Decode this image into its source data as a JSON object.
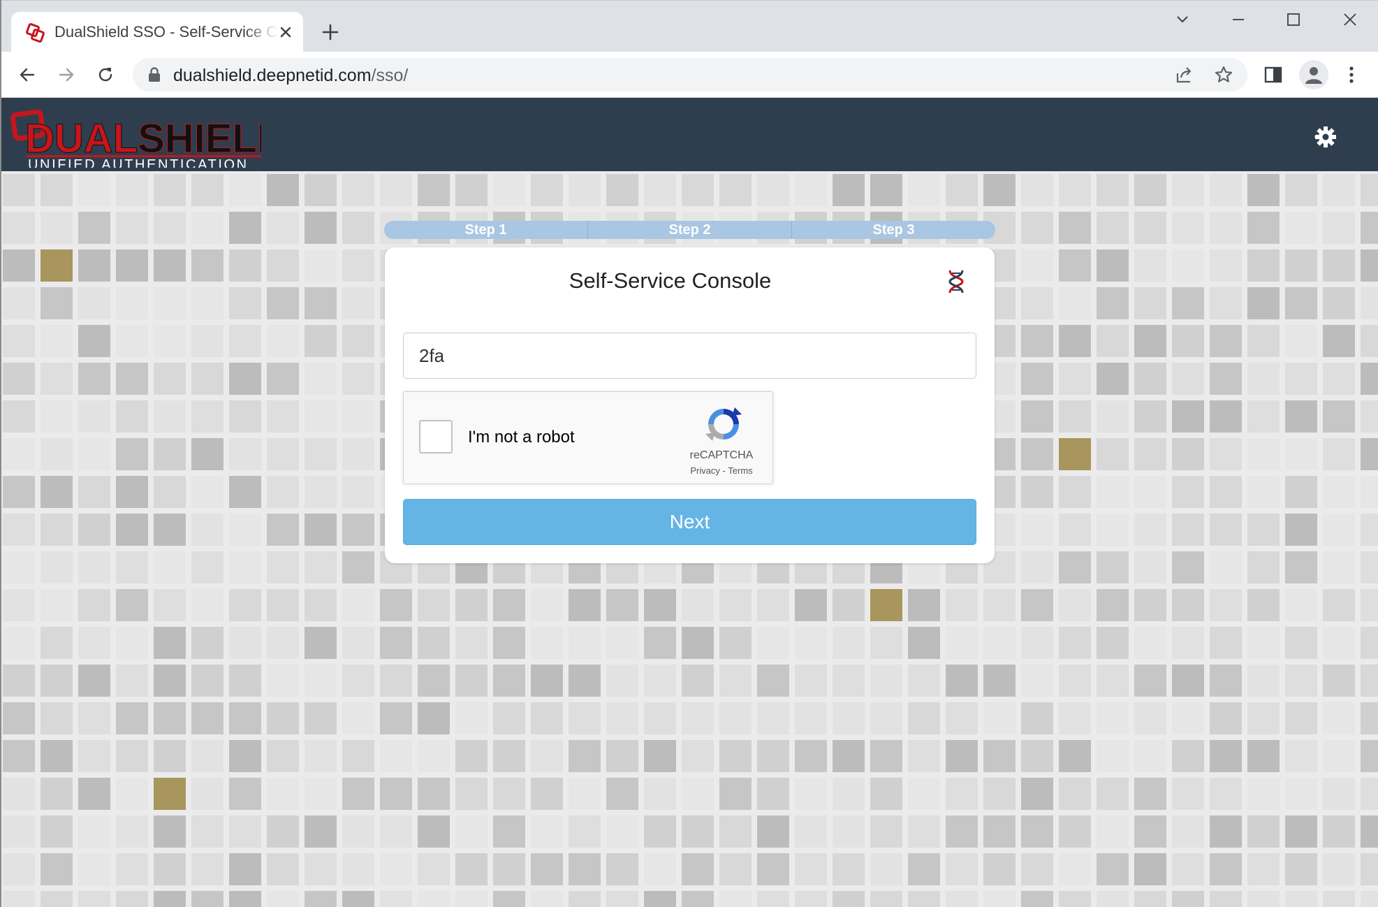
{
  "browser": {
    "tab_title": "DualShield SSO - Self-Service Console",
    "url_host": "dualshield.deepnetid.com",
    "url_path": "/sso/",
    "icons": [
      "dualshield-favicon-icon",
      "close-icon",
      "plus-icon",
      "chevron-down-icon",
      "minimize-icon",
      "maximize-icon",
      "close-icon",
      "back-arrow-icon",
      "forward-arrow-icon",
      "reload-icon",
      "lock-icon",
      "share-icon",
      "star-icon",
      "side-panel-icon",
      "profile-icon",
      "kebab-menu-icon"
    ]
  },
  "header": {
    "logo_name": "DUALSHIELD",
    "logo_name_red": "D",
    "logo_name_rest_red": "UAL",
    "logo_name_black": "SHIELD",
    "logo_tagline": "UNIFIED AUTHENTICATION",
    "settings_icon": "gear-icon"
  },
  "wizard": {
    "steps": [
      "Step 1",
      "Step 2",
      "Step 3"
    ],
    "title": "Self-Service Console",
    "username_value": "2fa",
    "recaptcha": {
      "label": "I'm not a robot",
      "brand": "reCAPTCHA",
      "privacy": "Privacy",
      "separator": "-",
      "terms": "Terms"
    },
    "next_label": "Next"
  },
  "colors": {
    "header_bg": "#2e3e4e",
    "step_bar": "#a9c6e2",
    "next_button": "#64b5e6",
    "brand_red": "#c4161c"
  }
}
